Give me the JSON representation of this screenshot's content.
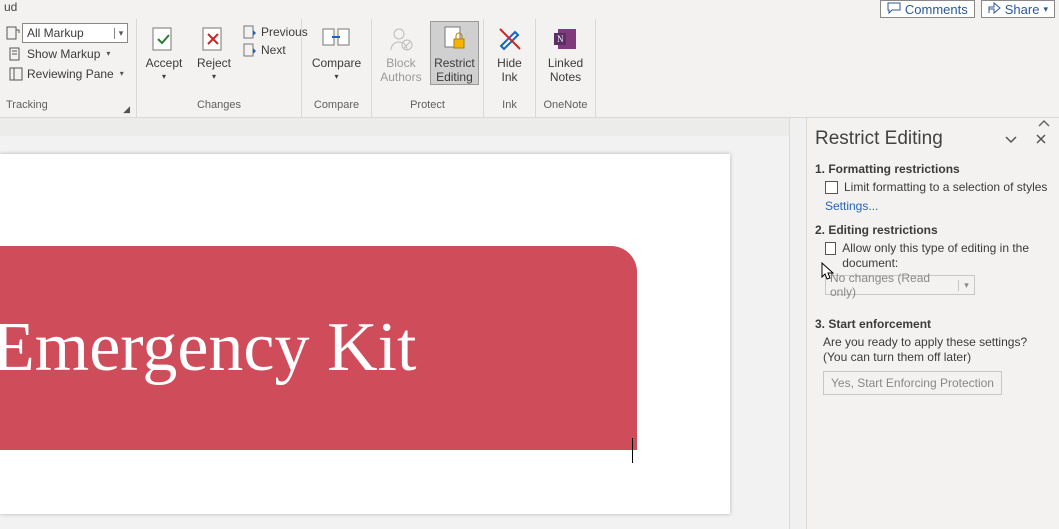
{
  "top": {
    "left_label": "ud",
    "comments": "Comments",
    "share": "Share"
  },
  "ribbon": {
    "tracking": {
      "markup_mode": "All Markup",
      "show_markup": "Show Markup",
      "reviewing_pane": "Reviewing Pane",
      "group_label": "Tracking"
    },
    "changes": {
      "accept": "Accept",
      "reject": "Reject",
      "previous": "Previous",
      "next": "Next",
      "group_label": "Changes"
    },
    "compare": {
      "button": "Compare",
      "group_label": "Compare"
    },
    "protect": {
      "block_authors": "Block\nAuthors",
      "restrict_editing": "Restrict\nEditing",
      "group_label": "Protect"
    },
    "ink": {
      "hide_ink": "Hide\nInk",
      "group_label": "Ink"
    },
    "onenote": {
      "linked_notes": "Linked\nNotes",
      "group_label": "OneNote"
    }
  },
  "document": {
    "title_text": "Emergency Kit"
  },
  "panel": {
    "title": "Restrict Editing",
    "s1_title": "1. Formatting restrictions",
    "s1_check_label": "Limit formatting to a selection of styles",
    "s1_settings": "Settings...",
    "s2_title": "2. Editing restrictions",
    "s2_check_label": "Allow only this type of editing in the document:",
    "s2_select_value": "No changes (Read only)",
    "s3_title": "3. Start enforcement",
    "s3_desc": "Are you ready to apply these settings? (You can turn them off later)",
    "s3_button": "Yes, Start Enforcing Protection"
  }
}
